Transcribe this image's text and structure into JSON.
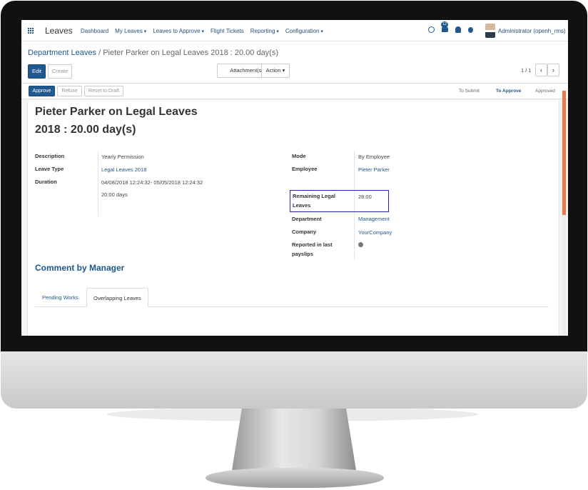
{
  "nav": {
    "app_title": "Leaves",
    "menu": [
      "Dashboard",
      "My Leaves",
      "Leaves to Approve",
      "Flight Tickets",
      "Reporting",
      "Configuration"
    ],
    "message_count": "12",
    "user_name": "Administrator (openh_rms)",
    "icons": [
      "apps-grid-icon",
      "clock-icon",
      "chat-icon",
      "bell-icon",
      "bug-icon"
    ]
  },
  "breadcrumb": {
    "parent": "Department Leaves",
    "separator": "/",
    "current": "Pieter Parker on Legal Leaves 2018 : 20.00 day(s)"
  },
  "toolbar": {
    "edit": "Edit",
    "create": "Create",
    "attachments": "Attachment(s)",
    "action": "Action",
    "pager": "1 / 1",
    "prev": "‹",
    "next": "›"
  },
  "statusbar": {
    "approve": "Approve",
    "refuse": "Refuse",
    "reset": "Reset to Draft",
    "stages": [
      "To Submit",
      "To Approve",
      "Approved"
    ],
    "active_stage": "To Approve"
  },
  "record": {
    "title_line1": "Pieter Parker on Legal Leaves",
    "title_line2": "2018 : 20.00 day(s)",
    "left": {
      "description_label": "Description",
      "description_value": "Yearly Permission",
      "leave_type_label": "Leave Type",
      "leave_type_value": "Legal Leaves 2018",
      "duration_label": "Duration",
      "duration_dates": "04/08/2018 12:24:32- 05/05/2018 12:24:32",
      "duration_days": "20.00 days"
    },
    "right": {
      "mode_label": "Mode",
      "mode_value": "By Employee",
      "employee_label": "Employee",
      "employee_value": "Pieter Parker",
      "remaining_label_1": "Remaining Legal",
      "remaining_label_2": "Leaves",
      "remaining_value": "28.00",
      "department_label": "Department",
      "department_value": "Management",
      "company_label": "Company",
      "company_value": "YourCompany",
      "payslips_label_1": "Reported in last",
      "payslips_label_2": "payslips"
    },
    "comment_title": "Comment by Manager",
    "tabs": [
      "Pending Works",
      "Overlapping Leaves"
    ],
    "active_tab": "Overlapping Leaves"
  },
  "colors": {
    "primary": "#20588f",
    "highlight_border": "#2626a8",
    "scrollbar": "#e67b4d"
  }
}
